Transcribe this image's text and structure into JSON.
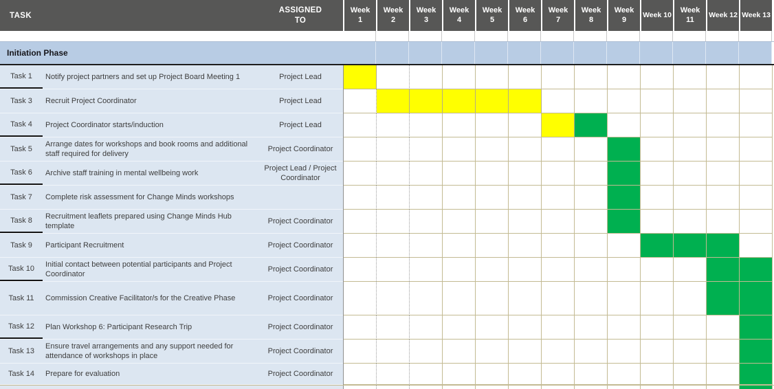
{
  "header": {
    "task_label": "TASK",
    "assigned_label": "ASSIGNED TO",
    "weeks": [
      "Week 1",
      "Week 2",
      "Week 3",
      "Week 4",
      "Week 5",
      "Week 6",
      "Week 7",
      "Week 8",
      "Week 9",
      "Week 10",
      "Week 11",
      "Week 12",
      "Week 13"
    ]
  },
  "phase": {
    "label": "Initiation Phase"
  },
  "tasks": [
    {
      "id": "Task 1",
      "desc": "Notify project partners and set up Project Board Meeting 1",
      "assigned": "Project Lead",
      "cells": [
        "Y",
        "",
        "",
        "",
        "",
        "",
        "",
        "",
        "",
        "",
        "",
        "",
        ""
      ]
    },
    {
      "id": "Task 3",
      "desc": "Recruit Project Coordinator",
      "assigned": "Project Lead",
      "cells": [
        "",
        "Y",
        "Y",
        "Y",
        "Y",
        "Y",
        "",
        "",
        "",
        "",
        "",
        "",
        ""
      ]
    },
    {
      "id": "Task 4",
      "desc": "Project Coordinator starts/induction",
      "assigned": "Project Lead",
      "cells": [
        "",
        "",
        "",
        "",
        "",
        "",
        "Y",
        "G",
        "",
        "",
        "",
        "",
        ""
      ]
    },
    {
      "id": "Task 5",
      "desc": "Arrange dates for workshops and book rooms and additional staff required for delivery",
      "assigned": "Project Coordinator",
      "cells": [
        "",
        "",
        "",
        "",
        "",
        "",
        "",
        "",
        "G",
        "",
        "",
        "",
        ""
      ]
    },
    {
      "id": "Task 6",
      "desc": "Archive staff training in mental wellbeing work",
      "assigned": "Project Lead / Project Coordinator",
      "cells": [
        "",
        "",
        "",
        "",
        "",
        "",
        "",
        "",
        "G",
        "",
        "",
        "",
        ""
      ]
    },
    {
      "id": "Task 7",
      "desc": "Complete risk assessment for Change Minds workshops",
      "assigned": "",
      "cells": [
        "",
        "",
        "",
        "",
        "",
        "",
        "",
        "",
        "G",
        "",
        "",
        "",
        ""
      ]
    },
    {
      "id": "Task 8",
      "desc": "Recruitment leaflets prepared using Change Minds Hub template",
      "assigned": "Project Coordinator",
      "cells": [
        "",
        "",
        "",
        "",
        "",
        "",
        "",
        "",
        "G",
        "",
        "",
        "",
        ""
      ]
    },
    {
      "id": "Task 9",
      "desc": "Participant Recruitment",
      "assigned": "Project Coordinator",
      "cells": [
        "",
        "",
        "",
        "",
        "",
        "",
        "",
        "",
        "",
        "G",
        "G",
        "G",
        ""
      ]
    },
    {
      "id": "Task 10",
      "desc": "Initial contact between potential participants and Project Coordinator",
      "assigned": "Project Coordinator",
      "cells": [
        "",
        "",
        "",
        "",
        "",
        "",
        "",
        "",
        "",
        "",
        "",
        "G",
        "G"
      ]
    },
    {
      "id": "Task 11",
      "desc": "Commission Creative Facilitator/s for the Creative Phase",
      "assigned": "Project Coordinator",
      "cells": [
        "",
        "",
        "",
        "",
        "",
        "",
        "",
        "",
        "",
        "",
        "",
        "G",
        "G"
      ]
    },
    {
      "id": "Task 12",
      "desc": "Plan Workshop 6: Participant Research Trip",
      "assigned": "Project Coordinator",
      "cells": [
        "",
        "",
        "",
        "",
        "",
        "",
        "",
        "",
        "",
        "",
        "",
        "",
        "G"
      ]
    },
    {
      "id": "Task 13",
      "desc": "Ensure travel arrangements and any support needed for attendance of workshops in place",
      "assigned": "Project Coordinator",
      "cells": [
        "",
        "",
        "",
        "",
        "",
        "",
        "",
        "",
        "",
        "",
        "",
        "",
        "G"
      ]
    },
    {
      "id": "Task 14",
      "desc": "Prepare for evaluation",
      "assigned": "Project Coordinator",
      "cells": [
        "",
        "",
        "",
        "",
        "",
        "",
        "",
        "",
        "",
        "",
        "",
        "",
        "G"
      ]
    }
  ],
  "partial_row": {
    "cells": [
      "",
      "",
      "",
      "",
      "",
      "",
      "",
      "",
      "",
      "",
      "",
      "",
      "G"
    ]
  },
  "colors": {
    "yellow": "#FFFF00",
    "green": "#00B050",
    "header_bg": "#575756",
    "phase_bg": "#B8CCE4",
    "row_bg": "#DCE6F1",
    "grid_border": "#C3BA92"
  }
}
